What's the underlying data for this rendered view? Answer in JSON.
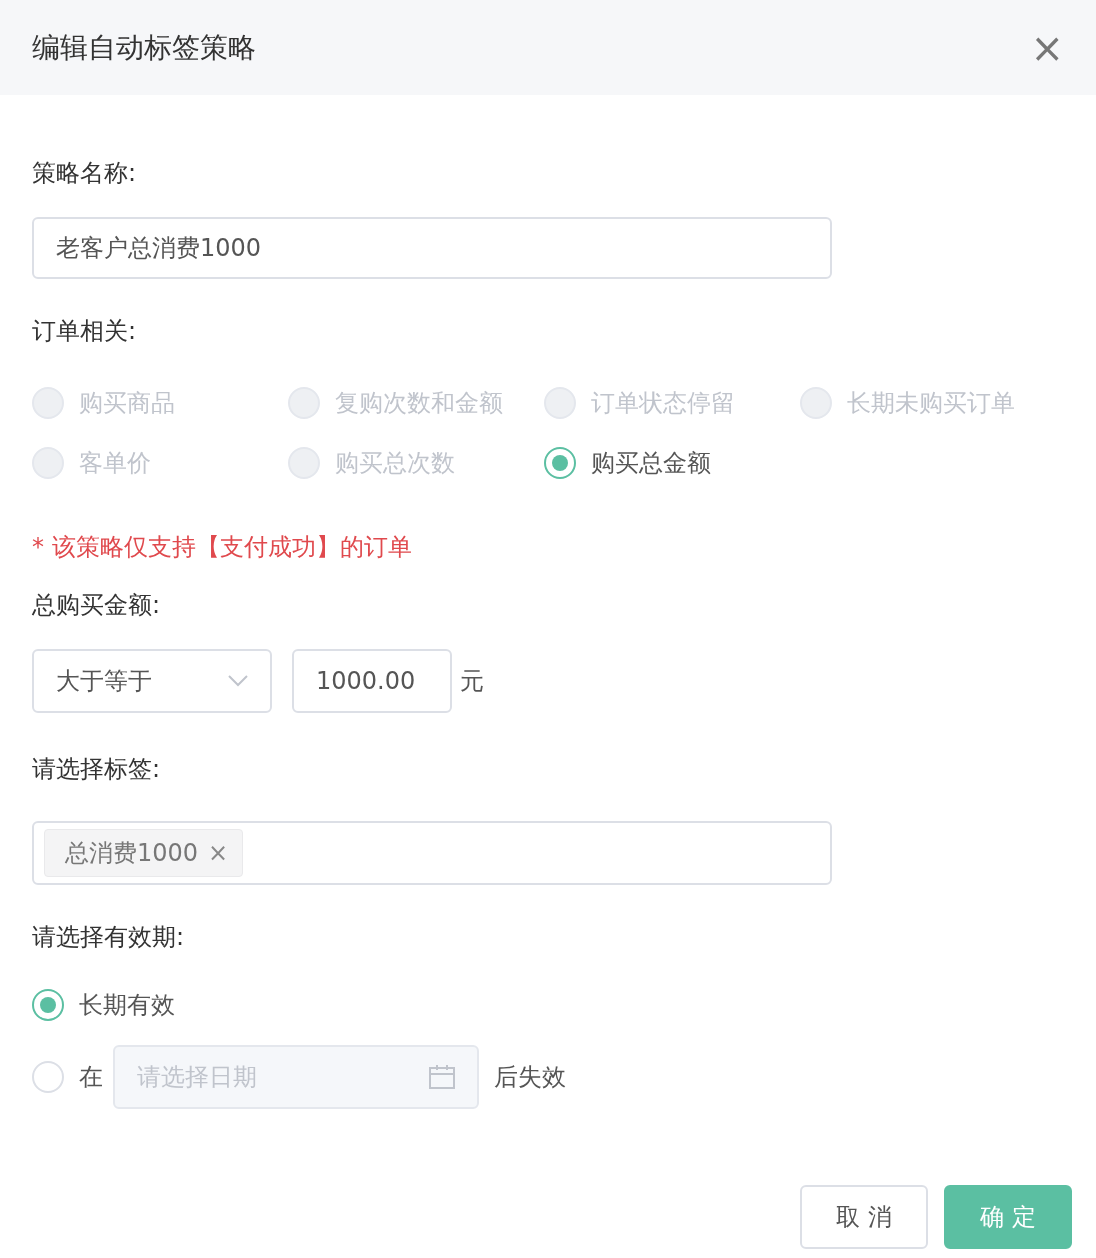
{
  "dialog": {
    "title": "编辑自动标签策略",
    "close": "×"
  },
  "name_field": {
    "label": "策略名称:",
    "value": "老客户总消费1000"
  },
  "order": {
    "label": "订单相关:",
    "options": [
      {
        "label": "购买商品",
        "selected": false,
        "disabled": true
      },
      {
        "label": "复购次数和金额",
        "selected": false,
        "disabled": true
      },
      {
        "label": "订单状态停留",
        "selected": false,
        "disabled": true
      },
      {
        "label": "长期未购买订单",
        "selected": false,
        "disabled": true
      },
      {
        "label": "客单价",
        "selected": false,
        "disabled": true
      },
      {
        "label": "购买总次数",
        "selected": false,
        "disabled": true
      },
      {
        "label": "购买总金额",
        "selected": true,
        "disabled": false
      }
    ]
  },
  "notice": "* 该策略仅支持【支付成功】的订单",
  "amount": {
    "label": "总购买金额:",
    "operator": "大于等于",
    "value": "1000.00",
    "unit": "元"
  },
  "tags": {
    "label": "请选择标签:",
    "items": [
      {
        "label": "总消费1000",
        "remove": "×"
      }
    ]
  },
  "validity": {
    "label": "请选择有效期:",
    "options": [
      {
        "kind": "plain",
        "label": "长期有效",
        "selected": true
      },
      {
        "kind": "date",
        "label": "在",
        "placeholder": "请选择日期",
        "suffix": "后失效",
        "selected": false
      }
    ]
  },
  "buttons": [
    {
      "label": "取 消",
      "kind": "default"
    },
    {
      "label": "确 定",
      "kind": "primary"
    }
  ]
}
